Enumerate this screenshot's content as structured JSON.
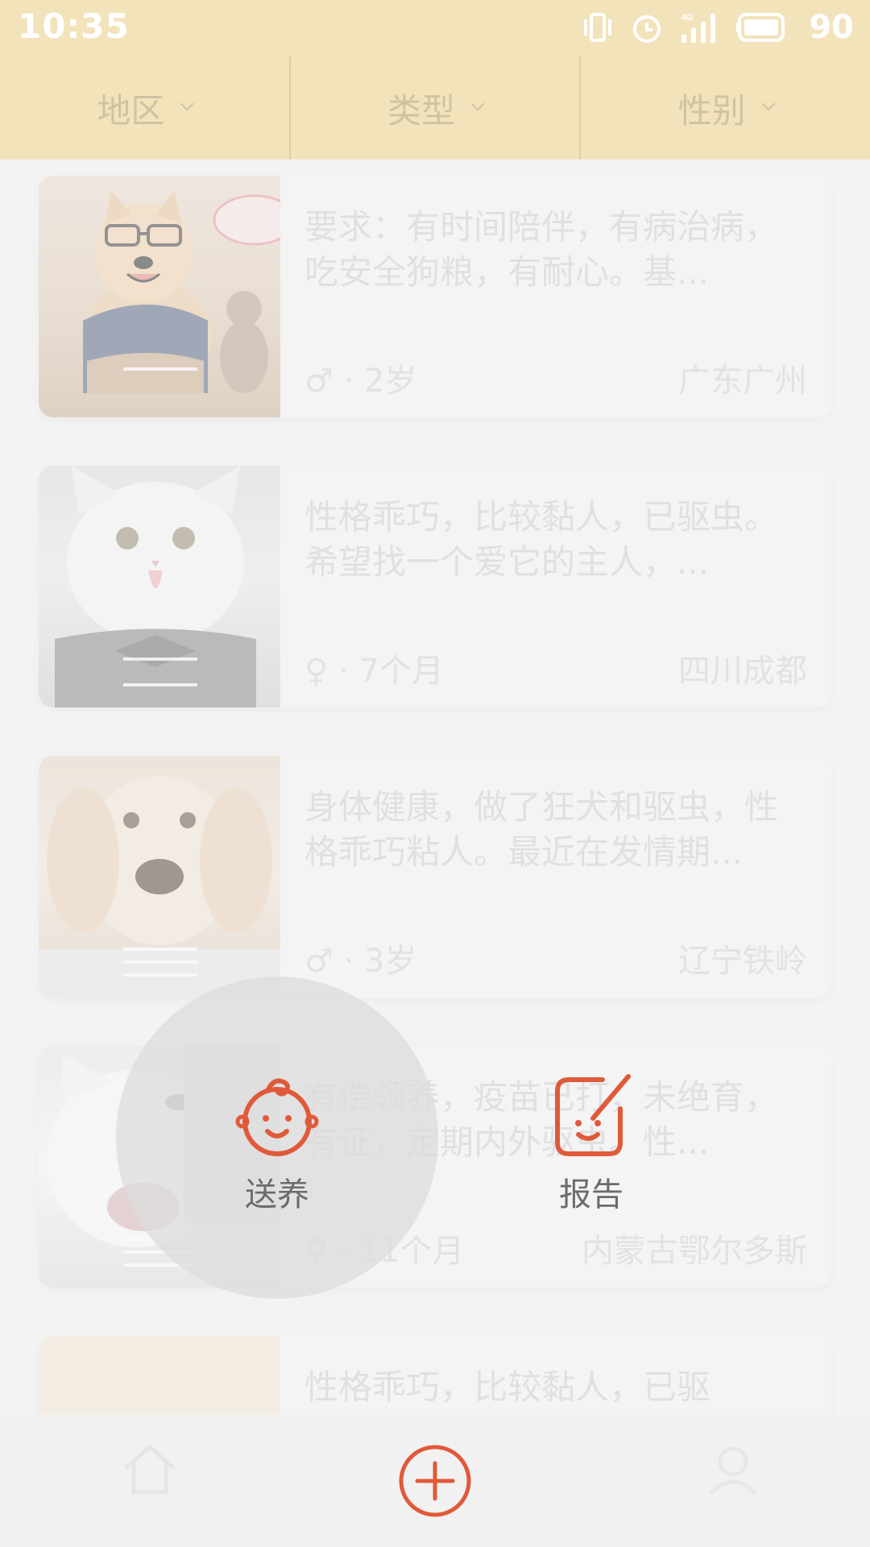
{
  "status_bar": {
    "time": "10:35",
    "battery": "90",
    "network": "4G"
  },
  "filters": [
    {
      "label": "地区"
    },
    {
      "label": "类型"
    },
    {
      "label": "性别"
    }
  ],
  "cards": [
    {
      "description": "要求：有时间陪伴，有病治病，吃安全狗粮，有耐心。基...",
      "gender_symbol": "♂",
      "age": "· 2岁",
      "location": "广东广州",
      "image_count": "1"
    },
    {
      "description": "性格乖巧，比较黏人，已驱虫。希望找一个爱它的主人，...",
      "gender_symbol": "♀",
      "age": "· 7个月",
      "location": "四川成都",
      "image_count": "2"
    },
    {
      "description": "身体健康，做了狂犬和驱虫，性格乖巧粘人。最近在发情期...",
      "gender_symbol": "♂",
      "age": "· 3岁",
      "location": "辽宁铁岭",
      "image_count": "3"
    },
    {
      "description": "有偿领养，疫苗已打，未绝育，有证，定期内外驱虫。性...",
      "gender_symbol": "♀",
      "age": "· 11个月",
      "location": "内蒙古鄂尔多斯",
      "image_count": "4"
    },
    {
      "description": "性格乖巧，比较黏人，已驱",
      "gender_symbol": "",
      "age": "",
      "location": "",
      "image_count": ""
    }
  ],
  "actions": {
    "give_away": {
      "label": "送养",
      "icon": "baby-face-icon"
    },
    "report": {
      "label": "报告",
      "icon": "report-edit-icon"
    }
  },
  "bottom_nav": {
    "home_icon": "home-icon",
    "add_icon": "add-circle-icon",
    "profile_icon": "profile-icon"
  },
  "colors": {
    "accent": "#e05a3a",
    "header": "#f2e3bb"
  }
}
